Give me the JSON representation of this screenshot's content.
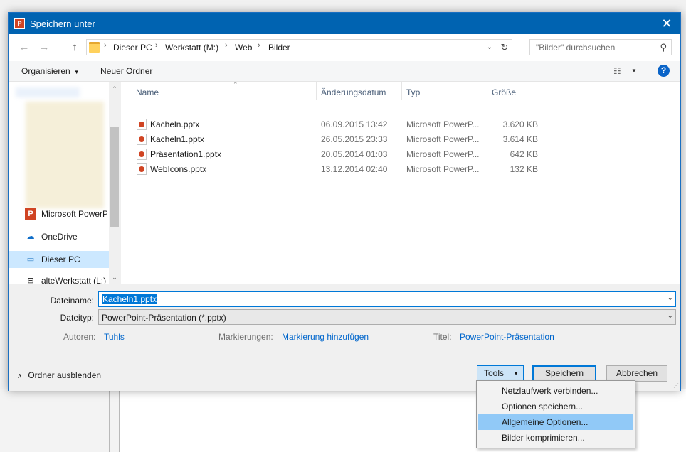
{
  "window": {
    "title": "Speichern unter",
    "app_icon_text": "P"
  },
  "nav_buttons": {
    "back": "←",
    "forward": "→",
    "up": "↑"
  },
  "address": {
    "crumbs": [
      "Dieser PC",
      "Werkstatt (M:)",
      "Web",
      "Bilder"
    ],
    "separator": "›",
    "dropdown": "⌄",
    "refresh": "↻"
  },
  "search": {
    "placeholder": "\"Bilder\" durchsuchen"
  },
  "toolbar": {
    "organize": "Organisieren",
    "new_folder": "Neuer Ordner",
    "help": "?"
  },
  "nav_pane": {
    "items": [
      {
        "label": "Microsoft PowerP",
        "icon": "powerpoint-icon"
      },
      {
        "label": "OneDrive",
        "icon": "onedrive-icon"
      },
      {
        "label": "Dieser PC",
        "icon": "computer-icon",
        "selected": true
      },
      {
        "label": "alteWerkstatt (L:)",
        "icon": "network-drive-icon"
      }
    ]
  },
  "file_list": {
    "columns": [
      "Name",
      "Änderungsdatum",
      "Typ",
      "Größe"
    ],
    "rows": [
      {
        "name": "Kacheln.pptx",
        "date": "06.09.2015 13:42",
        "type": "Microsoft PowerP...",
        "size": "3.620 KB"
      },
      {
        "name": "Kacheln1.pptx",
        "date": "26.05.2015 23:33",
        "type": "Microsoft PowerP...",
        "size": "3.614 KB"
      },
      {
        "name": "Präsentation1.pptx",
        "date": "20.05.2014 01:03",
        "type": "Microsoft PowerP...",
        "size": "642 KB"
      },
      {
        "name": "WebIcons.pptx",
        "date": "13.12.2014 02:40",
        "type": "Microsoft PowerP...",
        "size": "132 KB"
      }
    ]
  },
  "form": {
    "filename_label": "Dateiname:",
    "filename_value": "Kacheln1.pptx",
    "filetype_label": "Dateityp:",
    "filetype_value": "PowerPoint-Präsentation (*.pptx)",
    "authors_label": "Autoren:",
    "authors_value": "Tuhls",
    "tags_label": "Markierungen:",
    "tags_value": "Markierung hinzufügen",
    "title_label": "Titel:",
    "title_value": "PowerPoint-Präsentation"
  },
  "footer": {
    "hide_folders": "Ordner ausblenden",
    "tools": "Tools",
    "save": "Speichern",
    "cancel": "Abbrechen"
  },
  "tools_menu": {
    "items": [
      "Netzlaufwerk verbinden...",
      "Optionen speichern...",
      "Allgemeine Optionen...",
      "Bilder komprimieren..."
    ],
    "highlighted_index": 2
  },
  "colors": {
    "accent": "#0078d7",
    "titlebar": "#0063b1",
    "link": "#0066cc",
    "menu_highlight": "#91c9f7"
  }
}
